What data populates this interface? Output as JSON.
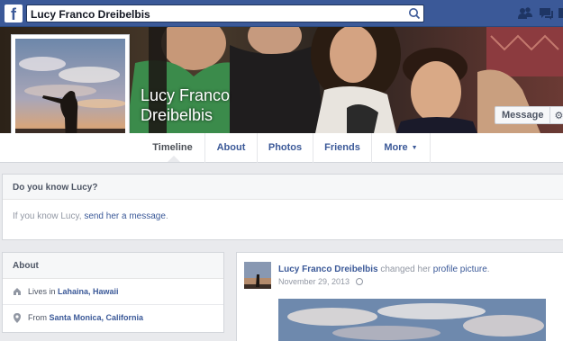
{
  "topbar": {
    "logo": "f",
    "search_value": "Lucy Franco Dreibelbis",
    "icons": [
      "friend-requests-icon",
      "messages-icon",
      "notifications-icon"
    ]
  },
  "profile": {
    "name_line1": "Lucy Franco",
    "name_line2": "Dreibelbis",
    "message_button": "Message",
    "gear_button": "⚙"
  },
  "tabs": [
    {
      "label": "Timeline"
    },
    {
      "label": "About"
    },
    {
      "label": "Photos"
    },
    {
      "label": "Friends"
    },
    {
      "label": "More"
    }
  ],
  "know": {
    "title": "Do you know Lucy?",
    "body_prefix": "If you know Lucy,",
    "link": "send her a message",
    "body_suffix": "."
  },
  "about": {
    "title": "About",
    "lives_prefix": "Lives in",
    "lives_place": "Lahaina, Hawaii",
    "from_prefix": "From",
    "from_place": "Santa Monica, California"
  },
  "post": {
    "author": "Lucy Franco Dreibelbis",
    "action": "changed her",
    "object": "profile picture",
    "suffix": ".",
    "date": "November 29, 2013"
  },
  "colors": {
    "brand": "#3b5998",
    "background": "#e9eaed",
    "link": "#3b5998",
    "muted": "#9197a3"
  }
}
